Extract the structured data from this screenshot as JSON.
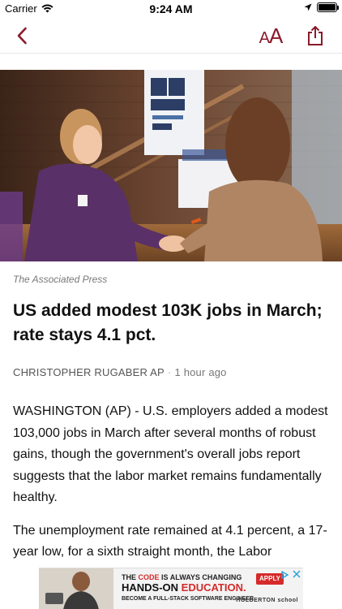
{
  "status_bar": {
    "carrier": "Carrier",
    "time": "9:24 AM"
  },
  "nav": {
    "back_icon": "chevron-left-icon",
    "font_size_label": "AA",
    "share_icon": "share-icon",
    "accent_color": "#8b1a2b"
  },
  "article": {
    "image_credit": "The Associated Press",
    "headline": "US added modest 103K jobs in March; rate stays 4.1 pct.",
    "author": "CHRISTOPHER RUGABER AP",
    "separator": "·",
    "time_ago": "1 hour ago",
    "paragraphs": [
      "WASHINGTON (AP) - U.S. employers added a modest 103,000 jobs in March after several months of robust gains, though the government's overall jobs report suggests that the labor market remains fundamentally healthy.",
      "The unemployment rate remained at 4.1 percent, a 17-year low, for a sixth straight month, the Labor"
    ]
  },
  "ad": {
    "line1_prefix": "THE ",
    "line1_code": "CODE",
    "line1_suffix": " IS ALWAYS CHANGING",
    "line2_prefix": "HANDS-ON ",
    "line2_highlight": "EDUCATION.",
    "line3": "BECOME A FULL-STACK SOFTWARE ENGINEER",
    "apply_label": "APPLY",
    "brand": "HOLBERTON",
    "brand_sub": "school"
  }
}
